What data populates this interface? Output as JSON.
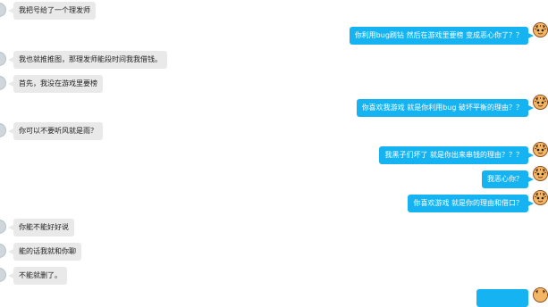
{
  "chat": {
    "messages": [
      {
        "side": "left",
        "text": "我把号给了一个理发师"
      },
      {
        "side": "right",
        "text": "你利用bug刷钻 然后在游戏里要榜 变成恶心你了？？"
      },
      {
        "side": "left",
        "text": "我也就推推图，那理发师能段时间我我借钱。"
      },
      {
        "side": "left",
        "text": "首先，我没在游戏里要榜"
      },
      {
        "side": "right",
        "text": "你喜欢我游戏 就是你利用bug 破坏平衡的理由？？"
      },
      {
        "side": "left",
        "text": "你可以不要听风就是雨？"
      },
      {
        "side": "right",
        "text": "我黑子们坏了 就是你出来串钱的理由？？？"
      },
      {
        "side": "right",
        "text": "我恶心你？"
      },
      {
        "side": "right",
        "text": "你喜欢游戏 就是你的理由和借口？"
      },
      {
        "side": "left",
        "text": "你能不能好好说"
      },
      {
        "side": "left",
        "text": "能的话我就和你聊"
      },
      {
        "side": "left",
        "text": "不能就删了。"
      },
      {
        "side": "right",
        "text": ""
      }
    ]
  },
  "colors": {
    "right_bubble": "#15b3f2",
    "left_bubble": "#e9e9e9",
    "background": "#ffffff"
  },
  "icons": {
    "left_avatar": "user-avatar-icon",
    "right_avatar": "tiger-avatar-icon"
  }
}
